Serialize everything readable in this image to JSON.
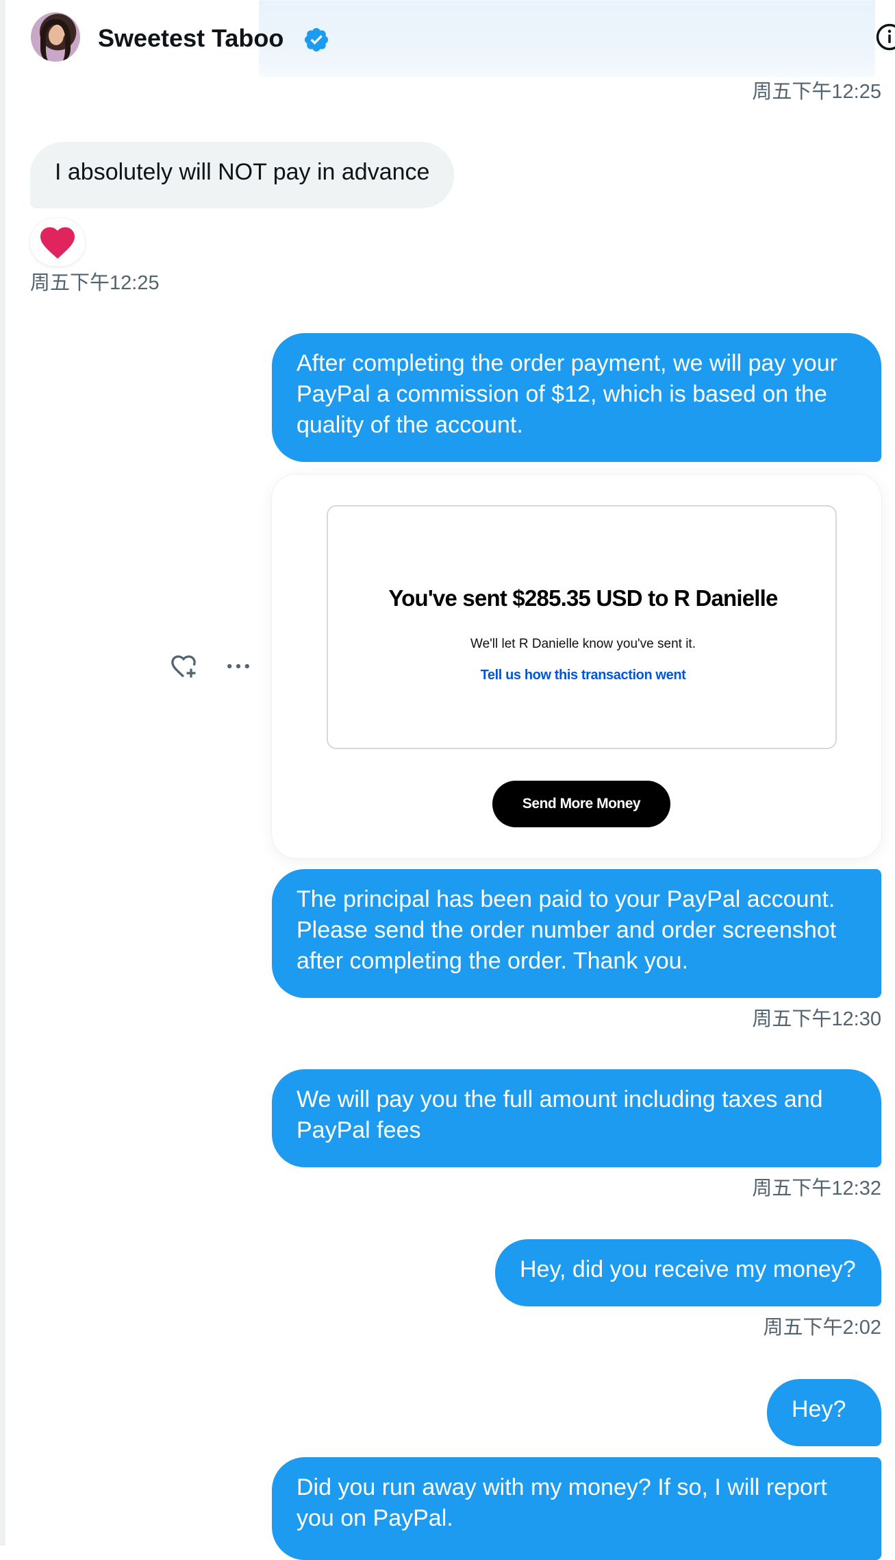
{
  "header": {
    "contact_name": "Sweetest Taboo",
    "verified_icon": "verified-badge-icon",
    "info_icon": "info-icon",
    "colors": {
      "verified": "#1d9bf0"
    }
  },
  "conversation": {
    "colors": {
      "outgoing": "#1d9bf0",
      "incoming": "#eff3f4",
      "timestamp": "#536471",
      "reaction": "#e0245e"
    },
    "timestamps": {
      "t0": "周五下午12:25",
      "t1": "周五下午12:25",
      "t2": "周五下午12:30",
      "t3": "周五下午12:32",
      "t4": "周五下午2:02"
    },
    "incoming": {
      "m1": "I absolutely will NOT pay in advance",
      "m1_reaction": "heart-icon"
    },
    "outgoing": {
      "m2": "After completing the order payment, we will pay your PayPal a commission of $12, which is based on the quality of the account.",
      "m3": "The principal has been paid to your PayPal account. Please send the order number and order screenshot after completing the order. Thank you.",
      "m4": "We will pay you the full amount including taxes and PayPal fees",
      "m5": "Hey, did you receive my money?",
      "m6": "Hey?",
      "m7": "Did you run away with my money? If so, I will report you on PayPal."
    },
    "image": {
      "title": "You've sent $285.35 USD to R Danielle",
      "subtitle": "We'll let R Danielle know you've sent it.",
      "link": "Tell us how this transaction went",
      "button": "Send More Money"
    },
    "actions": {
      "react_icon": "add-reaction-icon",
      "more_icon": "more-options-icon"
    }
  }
}
